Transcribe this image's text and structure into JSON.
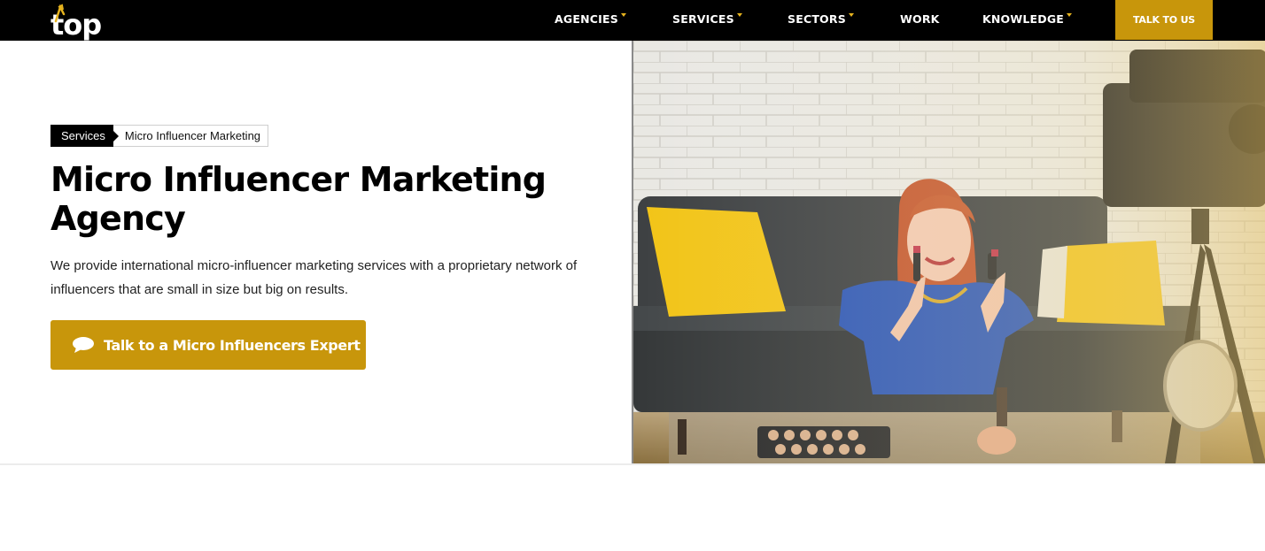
{
  "nav": {
    "logo_text": "top",
    "items": [
      {
        "label": "AGENCIES",
        "dropdown": true
      },
      {
        "label": "SERVICES",
        "dropdown": true
      },
      {
        "label": "SECTORS",
        "dropdown": true
      },
      {
        "label": "WORK",
        "dropdown": false
      },
      {
        "label": "KNOWLEDGE",
        "dropdown": true
      }
    ],
    "cta_label": "TALK TO US"
  },
  "hero": {
    "breadcrumb": {
      "parent": "Services",
      "current": "Micro Influencer Marketing"
    },
    "title": "Micro Influencer Marketing Agency",
    "description": "We provide international micro-influencer marketing services with a proprietary network of influencers that are small in size but big on results.",
    "cta_label": "Talk to a Micro Influencers Expert",
    "cta_icon": "chat-bubble-icon",
    "image": "woman-influencer-filming-makeup-video-photo"
  },
  "colors": {
    "accent": "#c8960b",
    "nav_bg": "#000000",
    "caret": "#e6b31e"
  }
}
